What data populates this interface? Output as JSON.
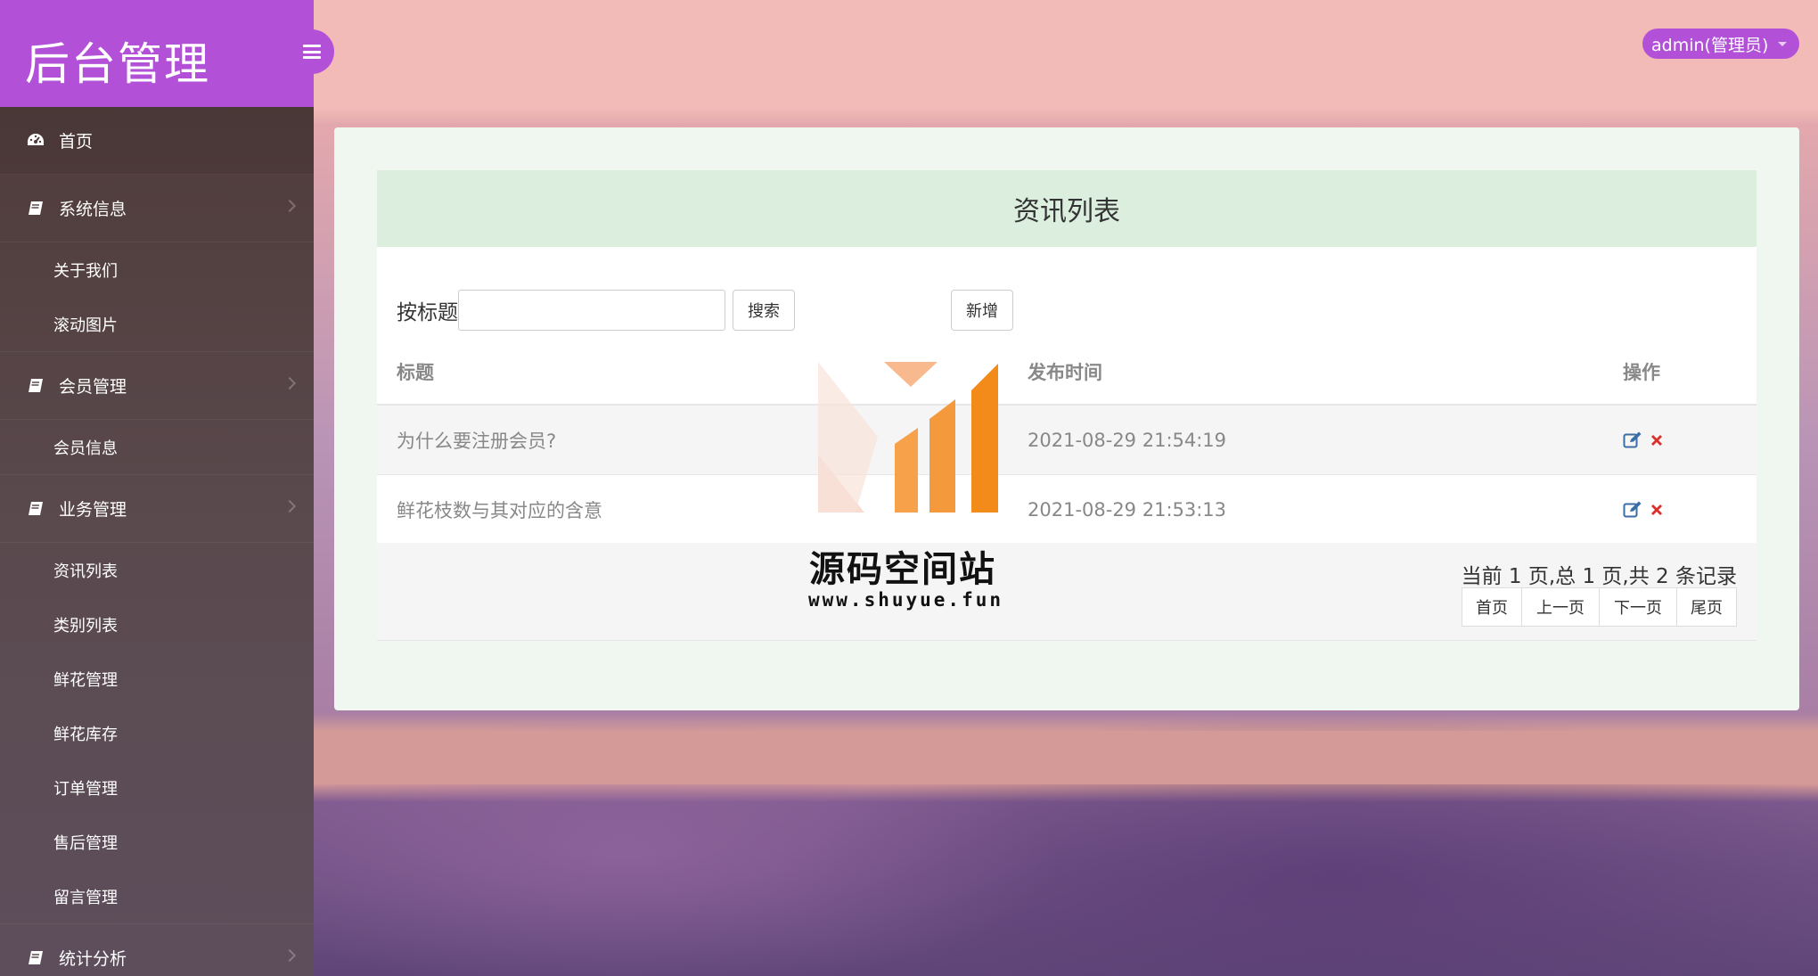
{
  "brand": {
    "title": "后台管理"
  },
  "header": {
    "user": "admin(管理员)"
  },
  "sidebar": {
    "items": [
      {
        "label": "首页",
        "icon": "dashboard-icon"
      },
      {
        "label": "系统信息",
        "icon": "book-icon",
        "children": [
          "关于我们",
          "滚动图片"
        ]
      },
      {
        "label": "会员管理",
        "icon": "book-icon",
        "children": [
          "会员信息"
        ]
      },
      {
        "label": "业务管理",
        "icon": "book-icon",
        "children": [
          "资讯列表",
          "类别列表",
          "鲜花管理",
          "鲜花库存",
          "订单管理",
          "售后管理",
          "留言管理"
        ]
      },
      {
        "label": "统计分析",
        "icon": "book-icon"
      }
    ]
  },
  "panel": {
    "title": "资讯列表",
    "search_label": "按标题",
    "search_value": "",
    "search_button": "搜索",
    "add_button": "新增"
  },
  "table": {
    "headers": [
      "标题",
      "发布时间",
      "操作"
    ],
    "rows": [
      {
        "title": "为什么要注册会员?",
        "time": "2021-08-29 21:54:19"
      },
      {
        "title": "鲜花枝数与其对应的含意",
        "time": "2021-08-29 21:53:13"
      }
    ]
  },
  "pagination": {
    "info": "当前 1 页,总 1 页,共 2 条记录",
    "buttons": [
      "首页",
      "上一页",
      "下一页",
      "尾页"
    ]
  },
  "watermark": {
    "name": "源码空间站",
    "url": "www.shuyue.fun",
    "colors": {
      "orange": "#f28b1a",
      "light": "#f6d2c6"
    }
  },
  "colors": {
    "accent": "#b350d8",
    "panel_head": "#dcefdf",
    "delete": "#d9302c",
    "edit": "#3a6ea5"
  }
}
